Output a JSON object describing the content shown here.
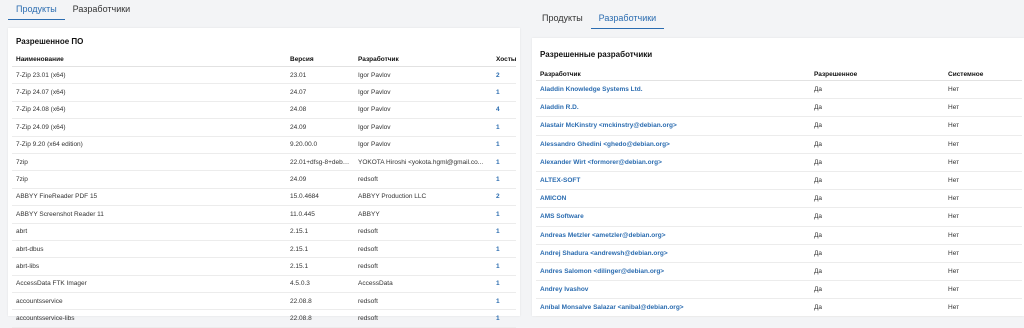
{
  "left": {
    "tabs": [
      {
        "label": "Продукты"
      },
      {
        "label": "Разработчики"
      }
    ],
    "title": "Разрешенное ПО",
    "columns": [
      "Наименование",
      "Версия",
      "Разработчик",
      "Хосты"
    ],
    "rows": [
      {
        "name": "7-Zip 23.01 (x64)",
        "version": "23.01",
        "developer": "Igor Pavlov",
        "hosts": "2"
      },
      {
        "name": "7-Zip 24.07 (x64)",
        "version": "24.07",
        "developer": "Igor Pavlov",
        "hosts": "1"
      },
      {
        "name": "7-Zip 24.08 (x64)",
        "version": "24.08",
        "developer": "Igor Pavlov",
        "hosts": "4"
      },
      {
        "name": "7-Zip 24.09 (x64)",
        "version": "24.09",
        "developer": "Igor Pavlov",
        "hosts": "1"
      },
      {
        "name": "7-Zip 9.20 (x64 edition)",
        "version": "9.20.00.0",
        "developer": "Igor Pavlov",
        "hosts": "1"
      },
      {
        "name": "7zip",
        "version": "22.01+dfsg-8+deb12u1",
        "developer": "YOKOTA Hiroshi <yokota.hgml@gmail.co...",
        "hosts": "1"
      },
      {
        "name": "7zip",
        "version": "24.09",
        "developer": "redsoft",
        "hosts": "1"
      },
      {
        "name": "ABBYY FineReader PDF 15",
        "version": "15.0.4684",
        "developer": "ABBYY Production LLC",
        "hosts": "2"
      },
      {
        "name": "ABBYY Screenshot Reader 11",
        "version": "11.0.445",
        "developer": "ABBYY",
        "hosts": "1"
      },
      {
        "name": "abrt",
        "version": "2.15.1",
        "developer": "redsoft",
        "hosts": "1"
      },
      {
        "name": "abrt-dbus",
        "version": "2.15.1",
        "developer": "redsoft",
        "hosts": "1"
      },
      {
        "name": "abrt-libs",
        "version": "2.15.1",
        "developer": "redsoft",
        "hosts": "1"
      },
      {
        "name": "AccessData FTK Imager",
        "version": "4.5.0.3",
        "developer": "AccessData",
        "hosts": "1"
      },
      {
        "name": "accountsservice",
        "version": "22.08.8",
        "developer": "redsoft",
        "hosts": "1"
      },
      {
        "name": "accountsservice-libs",
        "version": "22.08.8",
        "developer": "redsoft",
        "hosts": "1"
      }
    ]
  },
  "right": {
    "tabs": [
      {
        "label": "Продукты"
      },
      {
        "label": "Разработчики"
      }
    ],
    "title": "Разрешенные разработчики",
    "columns": [
      "Разработчик",
      "Разрешенное",
      "Системное"
    ],
    "rows": [
      {
        "developer": "Aladdin Knowledge Systems Ltd.",
        "allowed": "Да",
        "system": "Нет"
      },
      {
        "developer": "Aladdin R.D.",
        "allowed": "Да",
        "system": "Нет"
      },
      {
        "developer": "Alastair McKinstry <mckinstry@debian.org>",
        "allowed": "Да",
        "system": "Нет"
      },
      {
        "developer": "Alessandro Ghedini <ghedo@debian.org>",
        "allowed": "Да",
        "system": "Нет"
      },
      {
        "developer": "Alexander Wirt <formorer@debian.org>",
        "allowed": "Да",
        "system": "Нет"
      },
      {
        "developer": "ALTEX-SOFT",
        "allowed": "Да",
        "system": "Нет"
      },
      {
        "developer": "AMICON",
        "allowed": "Да",
        "system": "Нет"
      },
      {
        "developer": "AMS Software",
        "allowed": "Да",
        "system": "Нет"
      },
      {
        "developer": "Andreas Metzler <ametzler@debian.org>",
        "allowed": "Да",
        "system": "Нет"
      },
      {
        "developer": "Andrej Shadura <andrewsh@debian.org>",
        "allowed": "Да",
        "system": "Нет"
      },
      {
        "developer": "Andres Salomon <dilinger@debian.org>",
        "allowed": "Да",
        "system": "Нет"
      },
      {
        "developer": "Andrey Ivashov",
        "allowed": "Да",
        "system": "Нет"
      },
      {
        "developer": "Aníbal Monsalve Salazar <anibal@debian.org>",
        "allowed": "Да",
        "system": "Нет"
      }
    ]
  }
}
